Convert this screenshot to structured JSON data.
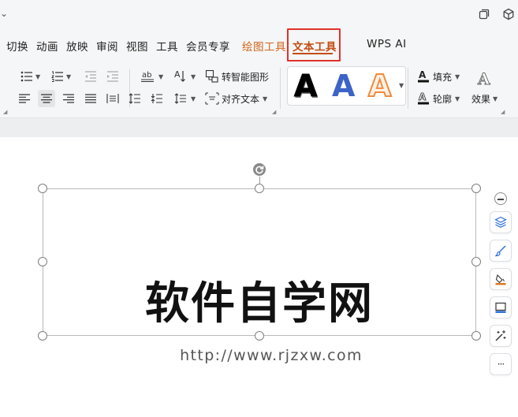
{
  "titlebar": {
    "collapse_chevron": "⌄",
    "icons": [
      "restore-window-icon",
      "cube-icon"
    ]
  },
  "menu": {
    "items": [
      {
        "label": "切换"
      },
      {
        "label": "动画"
      },
      {
        "label": "放映"
      },
      {
        "label": "审阅"
      },
      {
        "label": "视图"
      },
      {
        "label": "工具"
      },
      {
        "label": "会员专享"
      },
      {
        "label": "绘图工具"
      },
      {
        "label": "文本工具"
      },
      {
        "label": "WPS AI"
      }
    ],
    "active_tab": "文本工具",
    "active_color": "#c44b10",
    "highlight_color": "#e0322b",
    "drawing_tools_color": "#d4631a"
  },
  "ribbon": {
    "smart_shape_label": "转智能图形",
    "align_text_label": "对齐文本",
    "fill_label": "填充",
    "outline_label": "轮廓",
    "effects_label": "效果",
    "styles": [
      {
        "glyph": "A",
        "name": "black-white-outline"
      },
      {
        "glyph": "A",
        "name": "blue-fill"
      },
      {
        "glyph": "A",
        "name": "orange-outline"
      }
    ],
    "line_spacing_glyph": "ab"
  },
  "canvas": {
    "main_text": "软件自学网",
    "url_text": "http://www.rjzxw.com"
  },
  "side_toolbar": {
    "icons": [
      "layers-icon",
      "brush-icon",
      "fill-bucket-icon",
      "screen-icon",
      "magic-tools-icon",
      "more-icon"
    ],
    "more_label": "···"
  }
}
